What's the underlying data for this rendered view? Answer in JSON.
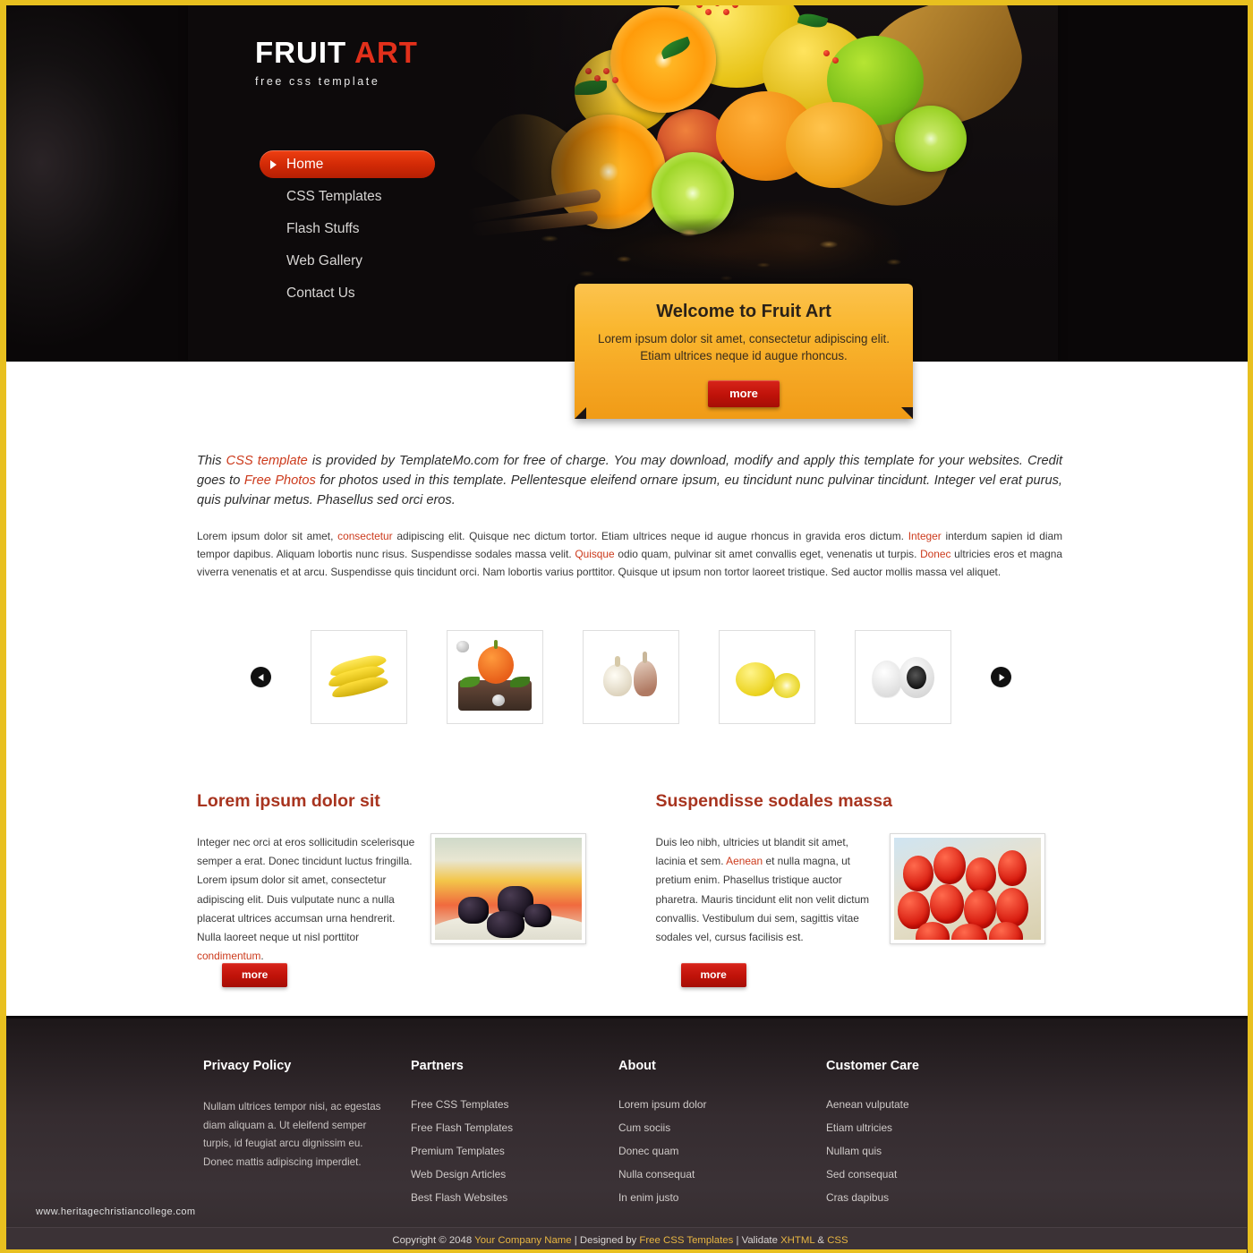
{
  "brand": {
    "name_main": "FRUIT",
    "name_accent": "ART",
    "tagline": "free css template",
    "accent_color": "#e2301b",
    "border_color": "#e8c01f"
  },
  "nav": {
    "items": [
      {
        "label": "Home",
        "active": true
      },
      {
        "label": "CSS Templates",
        "active": false
      },
      {
        "label": "Flash Stuffs",
        "active": false
      },
      {
        "label": "Web Gallery",
        "active": false
      },
      {
        "label": "Contact Us",
        "active": false
      }
    ]
  },
  "welcome": {
    "title": "Welcome to Fruit Art",
    "line1": "Lorem ipsum dolor sit amet, consectetur adipiscing elit.",
    "line2": "Etiam ultrices neque id augue rhoncus.",
    "button": "more"
  },
  "intro": {
    "p1_a": "This ",
    "link1": "CSS template",
    "p1_b": " is provided by TemplateMo.com for free of charge. You may download, modify and apply this template for your websites. Credit goes to ",
    "link2": "Free Photos",
    "p1_c": " for photos used in this template. Pellentesque eleifend ornare ipsum, eu tincidunt nunc pulvinar tincidunt. Integer vel erat purus, quis pulvinar metus. Phasellus sed orci eros."
  },
  "body": {
    "a": "Lorem ipsum dolor sit amet, ",
    "link1": "consectetur",
    "b": " adipiscing elit. Quisque nec dictum tortor. Etiam ultrices neque id augue rhoncus in gravida eros dictum. ",
    "link2": "Integer",
    "c": " interdum sapien id diam tempor dapibus. Aliquam lobortis nunc risus. Suspendisse sodales massa velit. ",
    "link3": "Quisque",
    "d": " odio quam, pulvinar sit amet convallis eget, venenatis ut turpis. ",
    "link4": "Donec",
    "e": " ultricies eros et magna viverra venenatis et at arcu. Suspendisse quis tincidunt orci. Nam lobortis varius porttitor. Quisque ut ipsum non tortor laoreet tristique. Sed auctor mollis massa vel aliquet."
  },
  "gallery": {
    "prev_label": "prev",
    "next_label": "next",
    "thumbs": [
      {
        "name": "bananas"
      },
      {
        "name": "pumpkin"
      },
      {
        "name": "garlic"
      },
      {
        "name": "lemons"
      },
      {
        "name": "mushrooms"
      }
    ]
  },
  "columns": [
    {
      "title": "Lorem ipsum dolor sit",
      "text_a": "Integer nec orci at eros sollicitudin scelerisque semper a erat. Donec tincidunt luctus fringilla. Lorem ipsum dolor sit amet, consectetur adipiscing elit. Duis vulputate nunc a nulla placerat ultrices accumsan urna hendrerit. Nulla laoreet neque ut nisl porttitor ",
      "link": "condimentum",
      "text_b": ".",
      "image": "blackberry-plate",
      "button": "more"
    },
    {
      "title": "Suspendisse sodales massa",
      "text_a": "Duis leo nibh, ultricies ut blandit sit amet, lacinia et sem. ",
      "link": "Aenean",
      "text_b": " et nulla magna, ut pretium enim. Phasellus tristique auctor pharetra. Mauris tincidunt elit non velit dictum convallis. Vestibulum dui sem, sagittis vitae sodales vel, cursus facilisis est.",
      "image": "cherry-tomatoes",
      "button": "more"
    }
  ],
  "footer": {
    "privacy": {
      "title": "Privacy Policy",
      "text": "Nullam ultrices tempor nisi, ac egestas diam aliquam a. Ut eleifend semper turpis, id feugiat arcu dignissim eu. Donec mattis adipiscing imperdiet."
    },
    "partners": {
      "title": "Partners",
      "links": [
        "Free CSS Templates",
        "Free Flash Templates",
        "Premium Templates",
        "Web Design Articles",
        "Best Flash Websites"
      ]
    },
    "about": {
      "title": "About",
      "links": [
        "Lorem ipsum dolor",
        "Cum sociis",
        "Donec quam",
        "Nulla consequat",
        "In enim justo"
      ]
    },
    "customer_care": {
      "title": "Customer Care",
      "links": [
        "Aenean vulputate",
        "Etiam ultricies",
        "Nullam quis",
        "Sed consequat",
        "Cras dapibus"
      ]
    },
    "watermark": "www.heritagechristiancollege.com",
    "copyright": {
      "prefix": "Copyright © 2048 ",
      "company": "Your Company Name",
      "mid": " | Designed by ",
      "designer": "Free CSS Templates",
      "sep": " | Validate ",
      "xhtml": "XHTML",
      "amp": " & ",
      "css": "CSS"
    }
  }
}
